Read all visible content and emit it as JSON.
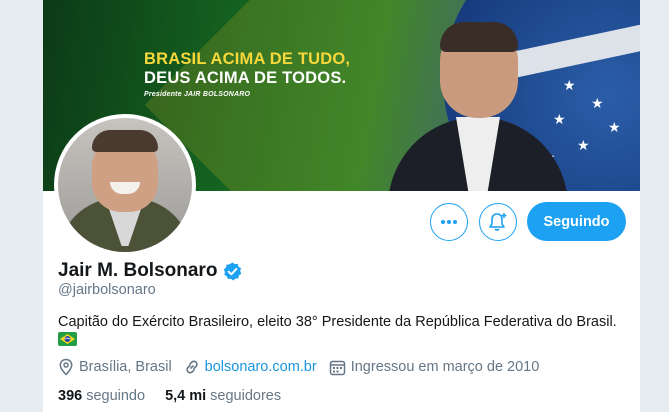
{
  "banner": {
    "slogan_line1": "BRASIL ACIMA DE TUDO,",
    "slogan_line2": "DEUS ACIMA DE TODOS.",
    "signature": "Presidente JAIR BOLSONARO",
    "colors": {
      "green": "#1d7a28",
      "yellow": "#f6d83b",
      "blue": "#173d80"
    }
  },
  "profile": {
    "name": "Jair M. Bolsonaro",
    "verified": true,
    "handle": "@jairbolsonaro",
    "bio": "Capitão do Exército Brasileiro, eleito 38° Presidente da República Federativa do Brasil.",
    "flag_icon": "brazil-flag-icon"
  },
  "actions": {
    "more_icon": "more-icon",
    "notify_icon": "bell-plus-icon",
    "follow_label": "Seguindo"
  },
  "meta": {
    "location": "Brasília, Brasil",
    "website": "bolsonaro.com.br",
    "joined": "Ingressou em março de 2010"
  },
  "stats": {
    "following_count": "396",
    "following_label": "seguindo",
    "followers_count": "5,4 mi",
    "followers_label": "seguidores"
  },
  "colors": {
    "accent": "#1da1f2",
    "link": "#1b95e0",
    "muted": "#657786",
    "text": "#14171a"
  }
}
